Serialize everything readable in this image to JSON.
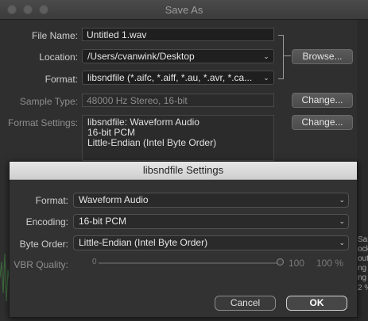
{
  "window": {
    "title": "Save As"
  },
  "form": {
    "file_name_label": "File Name:",
    "file_name_value": "Untitled 1.wav",
    "location_label": "Location:",
    "location_value": "/Users/cvanwink/Desktop",
    "format_label": "Format:",
    "format_value": "libsndfile (*.aifc, *.aiff, *.au, *.avr, *.ca...",
    "sample_type_label": "Sample Type:",
    "sample_type_value": "48000 Hz Stereo, 16-bit",
    "format_settings_label": "Format Settings:",
    "format_settings_lines": [
      "libsndfile: Waveform Audio",
      "16-bit PCM",
      "Little-Endian (Intel Byte Order)"
    ]
  },
  "buttons": {
    "browse": "Browse...",
    "change_sample": "Change...",
    "change_format": "Change..."
  },
  "sheet": {
    "title": "libsndfile Settings",
    "format_label": "Format:",
    "format_value": "Waveform Audio",
    "encoding_label": "Encoding:",
    "encoding_value": "16-bit PCM",
    "byte_order_label": "Byte Order:",
    "byte_order_value": "Little-Endian (Intel Byte Order)",
    "vbr_label": "VBR Quality:",
    "vbr_min": "0",
    "vbr_max_value": "100",
    "vbr_percent": "100 %",
    "vbr_level": 1.0,
    "cancel_label": "Cancel",
    "ok_label": "OK"
  },
  "background_window": {
    "fragments": [
      "San",
      "ock",
      "out",
      "ng D",
      "2 %",
      "ng"
    ]
  },
  "icons": {
    "chevron_double": "⌄",
    "chevron_updown": "⌃⌄"
  }
}
